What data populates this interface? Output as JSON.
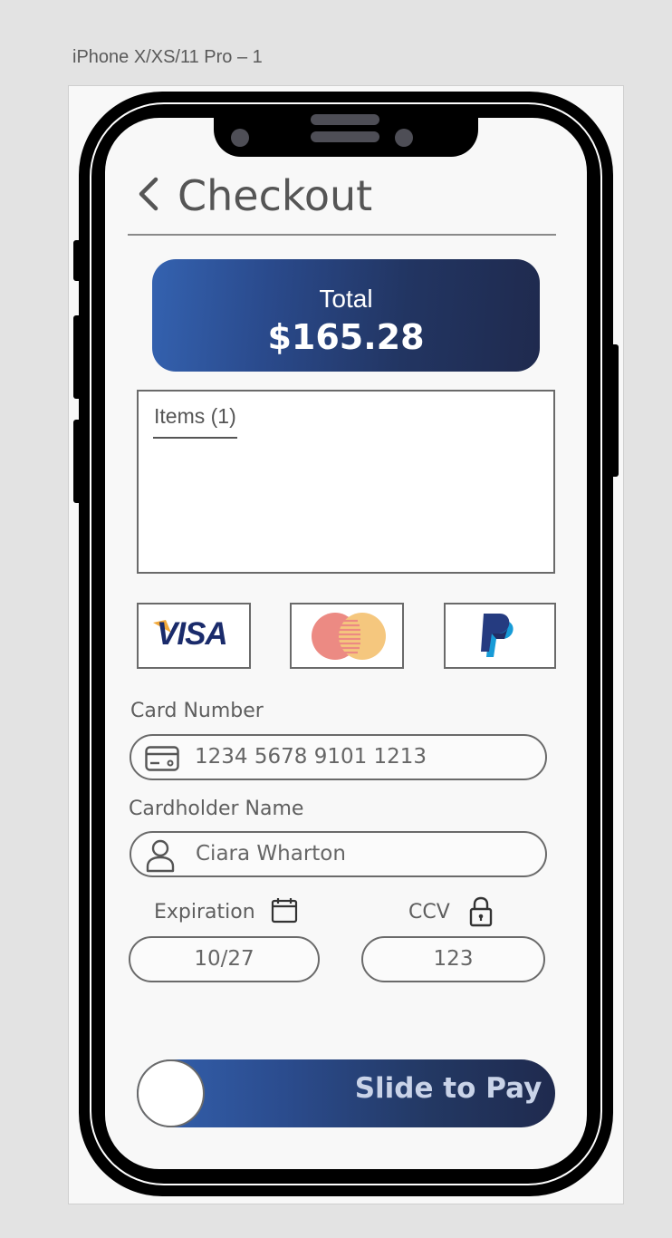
{
  "artboard": {
    "label": "iPhone X/XS/11 Pro – 1"
  },
  "header": {
    "title": "Checkout",
    "back_icon": "chevron-left-icon"
  },
  "total": {
    "label": "Total",
    "amount": "$165.28"
  },
  "items": {
    "label": "Items (1)"
  },
  "payment_methods": [
    {
      "name": "VISA",
      "icon": "visa-logo"
    },
    {
      "name": "Mastercard",
      "icon": "mastercard-logo"
    },
    {
      "name": "PayPal",
      "icon": "paypal-logo"
    }
  ],
  "form": {
    "card_number": {
      "label": "Card Number",
      "value": "1234 5678 9101 1213",
      "icon": "credit-card-icon"
    },
    "cardholder": {
      "label": "Cardholder Name",
      "value": "Ciara Wharton",
      "icon": "user-icon"
    },
    "expiration": {
      "label": "Expiration",
      "value": "10/27",
      "icon": "calendar-icon"
    },
    "ccv": {
      "label": "CCV",
      "value": "123",
      "icon": "lock-icon"
    }
  },
  "slider": {
    "label": "Slide to Pay"
  },
  "colors": {
    "accent_start": "#3462b0",
    "accent_end": "#1f2a4e",
    "mastercard_red": "#ec8a83",
    "mastercard_yellow": "#f5c77e",
    "paypal_dark": "#253b80",
    "paypal_light": "#179bd7"
  }
}
